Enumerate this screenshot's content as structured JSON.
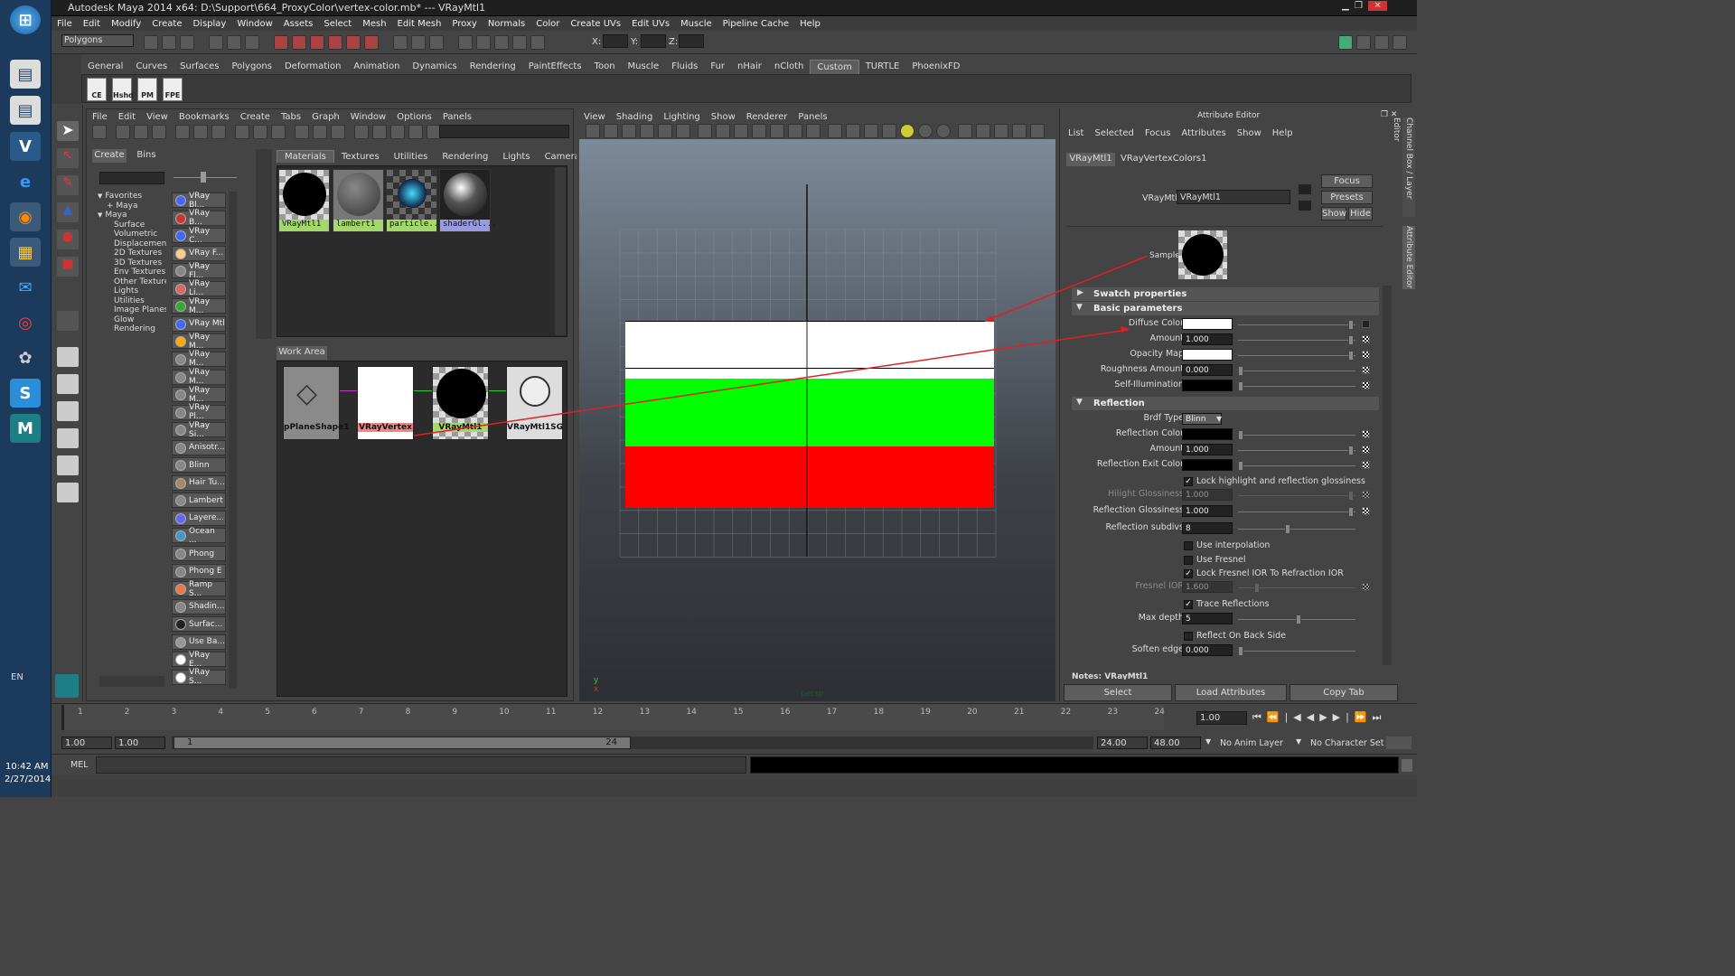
{
  "window": {
    "title": "Autodesk Maya 2014 x64: D:\\Support\\664_ProxyColor\\vertex-color.mb*   ---   VRayMtl1"
  },
  "menus": [
    "File",
    "Edit",
    "Modify",
    "Create",
    "Display",
    "Window",
    "Assets",
    "Select",
    "Mesh",
    "Edit Mesh",
    "Proxy",
    "Normals",
    "Color",
    "Create UVs",
    "Edit UVs",
    "Muscle",
    "Pipeline Cache",
    "Help"
  ],
  "status": {
    "mode": "Polygons",
    "x_label": "X:",
    "y_label": "Y:",
    "z_label": "Z:"
  },
  "shelf": {
    "tabs": [
      "General",
      "Curves",
      "Surfaces",
      "Polygons",
      "Deformation",
      "Animation",
      "Dynamics",
      "Rendering",
      "PaintEffects",
      "Toon",
      "Muscle",
      "Fluids",
      "Fur",
      "nHair",
      "nCloth",
      "Custom",
      "TURTLE",
      "PhoenixFD"
    ],
    "active_tab": "Custom",
    "buttons": [
      "CE",
      "Hshd",
      "PM",
      "FPE"
    ]
  },
  "hypershade": {
    "menus": [
      "File",
      "Edit",
      "View",
      "Bookmarks",
      "Create",
      "Tabs",
      "Graph",
      "Window",
      "Options",
      "Panels"
    ],
    "left_tabs": [
      "Create",
      "Bins"
    ],
    "tree": [
      "Favorites",
      "+ Maya",
      "Maya",
      "Surface",
      "Volumetric",
      "Displacement",
      "2D Textures",
      "3D Textures",
      "Env Textures",
      "Other Textures",
      "Lights",
      "Utilities",
      "Image Planes",
      "Glow",
      "Rendering"
    ],
    "node_list": [
      "VRay Bl...",
      "VRay B...",
      "VRay C...",
      "VRay F...",
      "VRay Fl...",
      "VRay Li...",
      "VRay M...",
      "VRay Mtl",
      "VRay M...",
      "VRay M...",
      "VRay M...",
      "VRay M...",
      "VRay Pl...",
      "VRay Si...",
      "Anisotr...",
      "Blinn",
      "Hair Tu...",
      "Lambert",
      "Layere...",
      "Ocean ...",
      "Phong",
      "Phong E",
      "Ramp S...",
      "Shadin...",
      "Surfac...",
      "Use Ba...",
      "VRay E...",
      "VRay S..."
    ],
    "top_tabs": [
      "Materials",
      "Textures",
      "Utilities",
      "Rendering",
      "Lights",
      "Cameras"
    ],
    "materials": [
      "VRayMtl1",
      "lambert1",
      "particle...",
      "shaderGl..."
    ],
    "work_area_tab": "Work Area",
    "nodes": [
      "pPlaneShape1",
      "VRayVertex",
      "VRayMtl1",
      "VRayMtl1SG"
    ]
  },
  "viewport": {
    "menus": [
      "View",
      "Shading",
      "Lighting",
      "Show",
      "Renderer",
      "Panels"
    ],
    "camera_label": "persp",
    "axis_y": "y",
    "axis_x": "x",
    "colors": {
      "white_band": "#ffffff",
      "green_band": "#00ff00",
      "red_band": "#ff0000"
    }
  },
  "attribute_editor": {
    "title": "Attribute Editor",
    "menus": [
      "List",
      "Selected",
      "Focus",
      "Attributes",
      "Show",
      "Help"
    ],
    "tabs": [
      "VRayMtl1",
      "VRayVertexColors1"
    ],
    "type_label": "VRayMtl:",
    "name_value": "VRayMtl1",
    "buttons": {
      "focus": "Focus",
      "presets": "Presets",
      "show": "Show",
      "hide": "Hide"
    },
    "sample_label": "Sample",
    "sections": {
      "swatch": "Swatch properties",
      "basic": "Basic parameters",
      "reflection": "Reflection"
    },
    "basic": {
      "diffuse_color": "Diffuse Color",
      "amount": "Amount",
      "amount_value": "1.000",
      "opacity_map": "Opacity Map",
      "roughness": "Roughness Amount",
      "roughness_value": "0.000",
      "self_illum": "Self-Illumination"
    },
    "reflection": {
      "brdf": "Brdf Type",
      "brdf_value": "Blinn",
      "refl_color": "Reflection Color",
      "amount": "Amount",
      "amount_value": "1.000",
      "exit_color": "Reflection Exit Color",
      "lock_label": "Lock highlight and reflection glossiness",
      "hilight": "Hilight Glossiness",
      "hilight_value": "1.000",
      "refl_gloss": "Reflection Glossiness",
      "refl_gloss_value": "1.000",
      "subdivs": "Reflection subdivs",
      "subdivs_value": "8",
      "use_interp": "Use interpolation",
      "use_fresnel": "Use Fresnel",
      "lock_fresnel": "Lock Fresnel IOR To Refraction IOR",
      "fresnel_ior": "Fresnel IOR",
      "fresnel_ior_value": "1.600",
      "trace": "Trace Reflections",
      "max_depth": "Max depth",
      "max_depth_value": "5",
      "back_side": "Reflect On Back Side",
      "soften": "Soften edge",
      "soften_value": "0.000"
    },
    "notes": "Notes: VRayMtl1",
    "bottom_buttons": [
      "Select",
      "Load Attributes",
      "Copy Tab"
    ]
  },
  "side_tabs": {
    "channel_box": "Channel Box / Layer Editor",
    "attribute_editor": "Attribute Editor"
  },
  "timeline": {
    "ticks": [
      "1",
      "2",
      "3",
      "4",
      "5",
      "6",
      "7",
      "8",
      "9",
      "10",
      "11",
      "12",
      "13",
      "14",
      "15",
      "16",
      "17",
      "18",
      "19",
      "20",
      "21",
      "22",
      "23",
      "24"
    ],
    "current": "1.00",
    "range_start": "1.00",
    "range_start2": "1.00",
    "range_slider_start": "1",
    "range_slider_end": "24",
    "end": "24.00",
    "end2": "48.00",
    "anim_layer": "No Anim Layer",
    "char_set": "No Character Set"
  },
  "command_line": {
    "label": "MEL"
  },
  "system": {
    "lang": "EN",
    "time": "10:42 AM",
    "date": "2/27/2014"
  }
}
